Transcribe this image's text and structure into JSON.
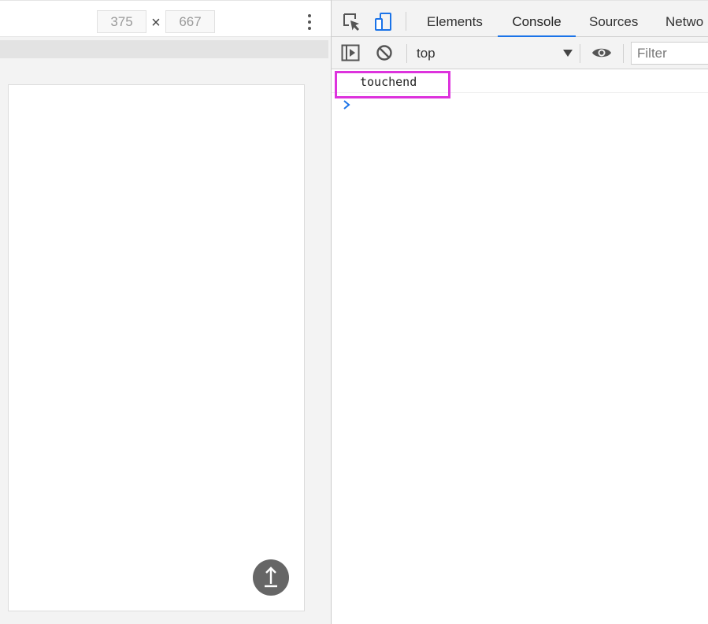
{
  "device_toolbar": {
    "width_value": "375",
    "times_symbol": "×",
    "height_value": "667",
    "more_options_icon": "kebab-vertical-icon"
  },
  "device_viewport": {
    "fab_icon": "arrow-up-icon",
    "fab_color": "#666666"
  },
  "devtools": {
    "tabs": [
      {
        "label": "Elements",
        "active": false
      },
      {
        "label": "Console",
        "active": true
      },
      {
        "label": "Sources",
        "active": false
      },
      {
        "label": "Netwo",
        "active": false
      }
    ],
    "toolbar_icons": [
      "inspect-element-icon",
      "device-toggle-icon"
    ],
    "accent_color": "#1a73e8",
    "console_toolbar": {
      "context": "top",
      "filter_placeholder": "Filter",
      "icons": [
        "sidebar-toggle-icon",
        "clear-console-icon",
        "dropdown-arrow-icon",
        "eye-icon"
      ]
    },
    "console_messages": [
      {
        "text": "touchend",
        "highlighted": true
      }
    ],
    "highlight_color": "#dd33dd",
    "prompt_icon": "chevron-right-icon"
  }
}
